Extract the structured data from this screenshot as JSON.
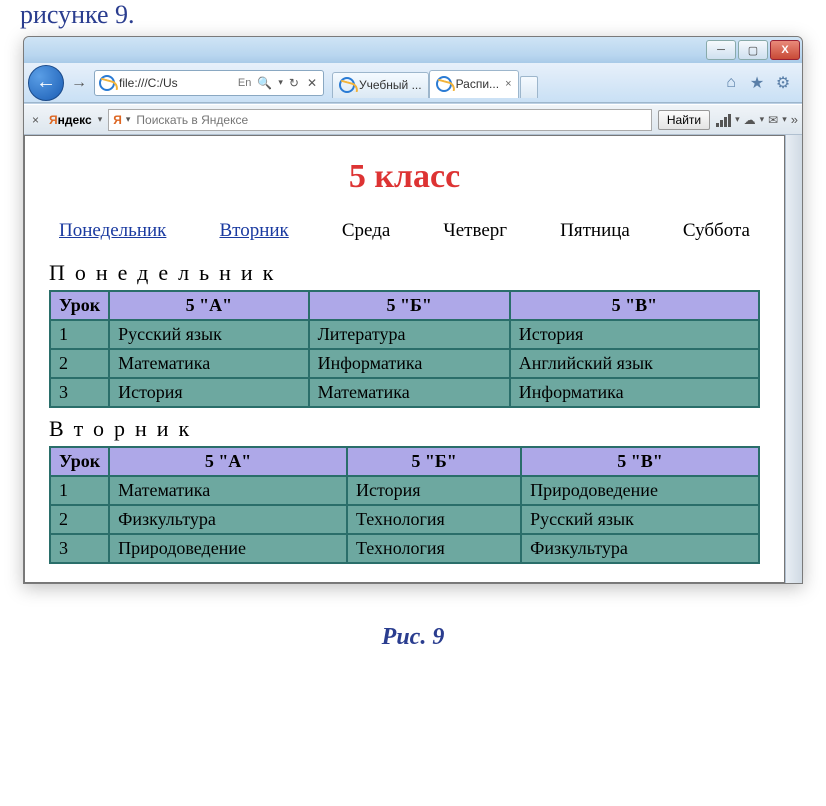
{
  "outer": {
    "fragment_text": "рисунке 9.",
    "caption": "Рис. 9"
  },
  "titlebar": {
    "minimize_glyph": "─",
    "maximize_glyph": "▢",
    "close_glyph": "X"
  },
  "nav": {
    "back_glyph": "←",
    "fwd_glyph": "→",
    "url": "file:///C:/Us",
    "lang_hint": "En",
    "search_glyph": "🔍",
    "dropdown_glyph": "▾",
    "refresh_glyph": "↻",
    "stop_glyph": "✕"
  },
  "tabs": [
    {
      "label": "Учебный ...",
      "active": false
    },
    {
      "label": "Распи...",
      "active": true
    }
  ],
  "tool_icons": {
    "home_glyph": "⌂",
    "star_glyph": "★",
    "gear_glyph": "⚙"
  },
  "yandex": {
    "close_glyph": "×",
    "brand_first": "Я",
    "brand_rest": "ндекс",
    "mini_logo": "Я",
    "placeholder": "Поискать в Яндексе",
    "find_label": "Найти",
    "caret": "▾",
    "cloud_glyph": "☁",
    "mail_glyph": "✉",
    "overflow_glyph": "»"
  },
  "page": {
    "title": "5 класс",
    "days_linked": [
      "Понедельник",
      "Вторник"
    ],
    "days_plain": [
      "Среда",
      "Четверг",
      "Пятница",
      "Суббота"
    ],
    "headers": [
      "Урок",
      "5 \"А\"",
      "5 \"Б\"",
      "5 \"В\""
    ],
    "sections": [
      {
        "heading": "Понедельник",
        "rows": [
          [
            "1",
            "Русский язык",
            "Литература",
            "История"
          ],
          [
            "2",
            "Математика",
            "Информатика",
            "Английский язык"
          ],
          [
            "3",
            "История",
            "Математика",
            "Информатика"
          ]
        ]
      },
      {
        "heading": "Вторник",
        "rows": [
          [
            "1",
            "Математика",
            "История",
            "Природоведение"
          ],
          [
            "2",
            "Физкультура",
            "Технология",
            "Русский язык"
          ],
          [
            "3",
            "Природоведение",
            "Технология",
            "Физкультура"
          ]
        ]
      }
    ]
  }
}
